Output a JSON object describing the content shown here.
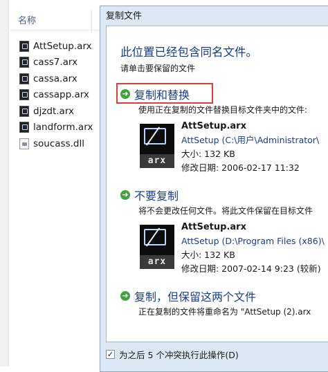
{
  "explorer": {
    "column_header": "名称",
    "files": [
      {
        "name": "AttSetup.arx",
        "type": "arx"
      },
      {
        "name": "cass7.arx",
        "type": "arx"
      },
      {
        "name": "cassa.arx",
        "type": "arx"
      },
      {
        "name": "cassapp.arx",
        "type": "arx"
      },
      {
        "name": "djzdt.arx",
        "type": "arx"
      },
      {
        "name": "landform.arx",
        "type": "arx"
      },
      {
        "name": "soucass.dll",
        "type": "dll"
      }
    ]
  },
  "dialog": {
    "title": "复制文件",
    "headline": "此位置已经包含同名文件。",
    "instruction": "请单击要保留的文件",
    "options": [
      {
        "title": "复制和替换",
        "desc": "使用正在复制的文件替换目标文件夹中的文件:",
        "file": {
          "name": "AttSetup.arx",
          "path": "AttSetup (C:\\用户\\Administrator\\",
          "size": "大小: 132 KB",
          "date": "修改日期: 2006-02-17 11:32"
        }
      },
      {
        "title": "不要复制",
        "desc": "将不会更改任何文件。将此文件保留在目标文件",
        "file": {
          "name": "AttSetup.arx",
          "path": "AttSetup (D:\\Program Files (x86)\\",
          "size": "大小: 132 KB",
          "date": "修改日期: 2007-02-14 9:23 (较新)"
        }
      },
      {
        "title": "复制，但保留这两个文件",
        "desc": "正在复制的文件将重命名为 \"AttSetup (2).arx"
      }
    ],
    "thumb_label": "arx",
    "footer": {
      "checkbox_mark": "✓",
      "label": "为之后 5 个冲突执行此操作(D)"
    }
  },
  "colors": {
    "link_blue": "#1a3d8f",
    "highlight_red": "#d8403a",
    "arrow_green": "#43a23f"
  }
}
